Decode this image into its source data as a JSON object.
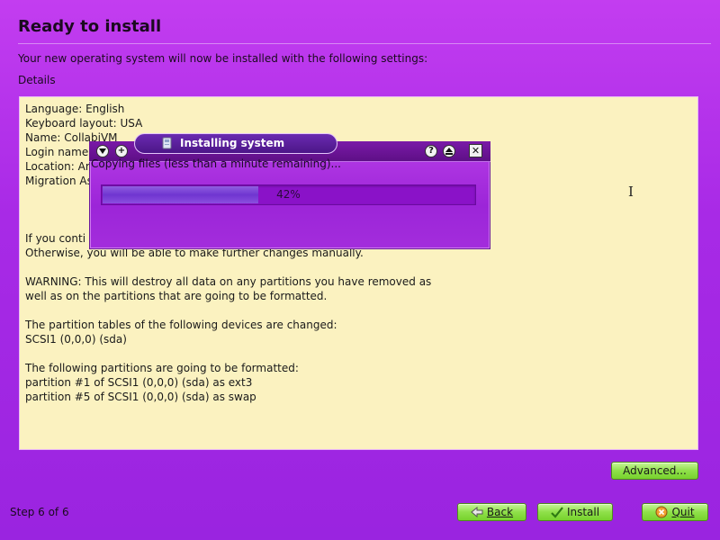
{
  "page": {
    "title": "Ready to install",
    "intro": "Your new operating system will now be installed with the following settings:",
    "details_label": "Details",
    "details_lines": [
      "Language: English",
      "Keyboard layout: USA",
      "Name: CollabiVM",
      "Login name",
      "Location: Am",
      "Migration As",
      "",
      "",
      "",
      "If you conti",
      "Otherwise, you will be able to make further changes manually.",
      "",
      "WARNING: This will destroy all data on any partitions you have removed as",
      "well as on the partitions that are going to be formatted.",
      "",
      "The partition tables of the following devices are changed:",
      "SCSI1 (0,0,0) (sda)",
      "",
      "The following partitions are going to be formatted:",
      "partition #1 of SCSI1 (0,0,0) (sda) as ext3",
      "partition #5 of SCSI1 (0,0,0) (sda) as swap"
    ]
  },
  "dialog": {
    "title": "Installing system",
    "status": "Copying files (less than a minute remaining)...",
    "progress_percent": 42,
    "progress_label": "42%",
    "titlebar_icons": [
      "menu-down-icon",
      "plus-icon",
      "help-icon",
      "shade-icon",
      "close-icon"
    ]
  },
  "footer": {
    "step": "Step 6 of 6",
    "advanced_label": "Advanced...",
    "back_label": "Back",
    "install_label": "Install",
    "quit_label": "Quit"
  },
  "colors": {
    "background": "#a82ae6",
    "details_bg": "#fbf2c0",
    "button_green": "#8fe04a",
    "progress_track": "#8a12c8",
    "progress_fill": "#6f35d0"
  }
}
